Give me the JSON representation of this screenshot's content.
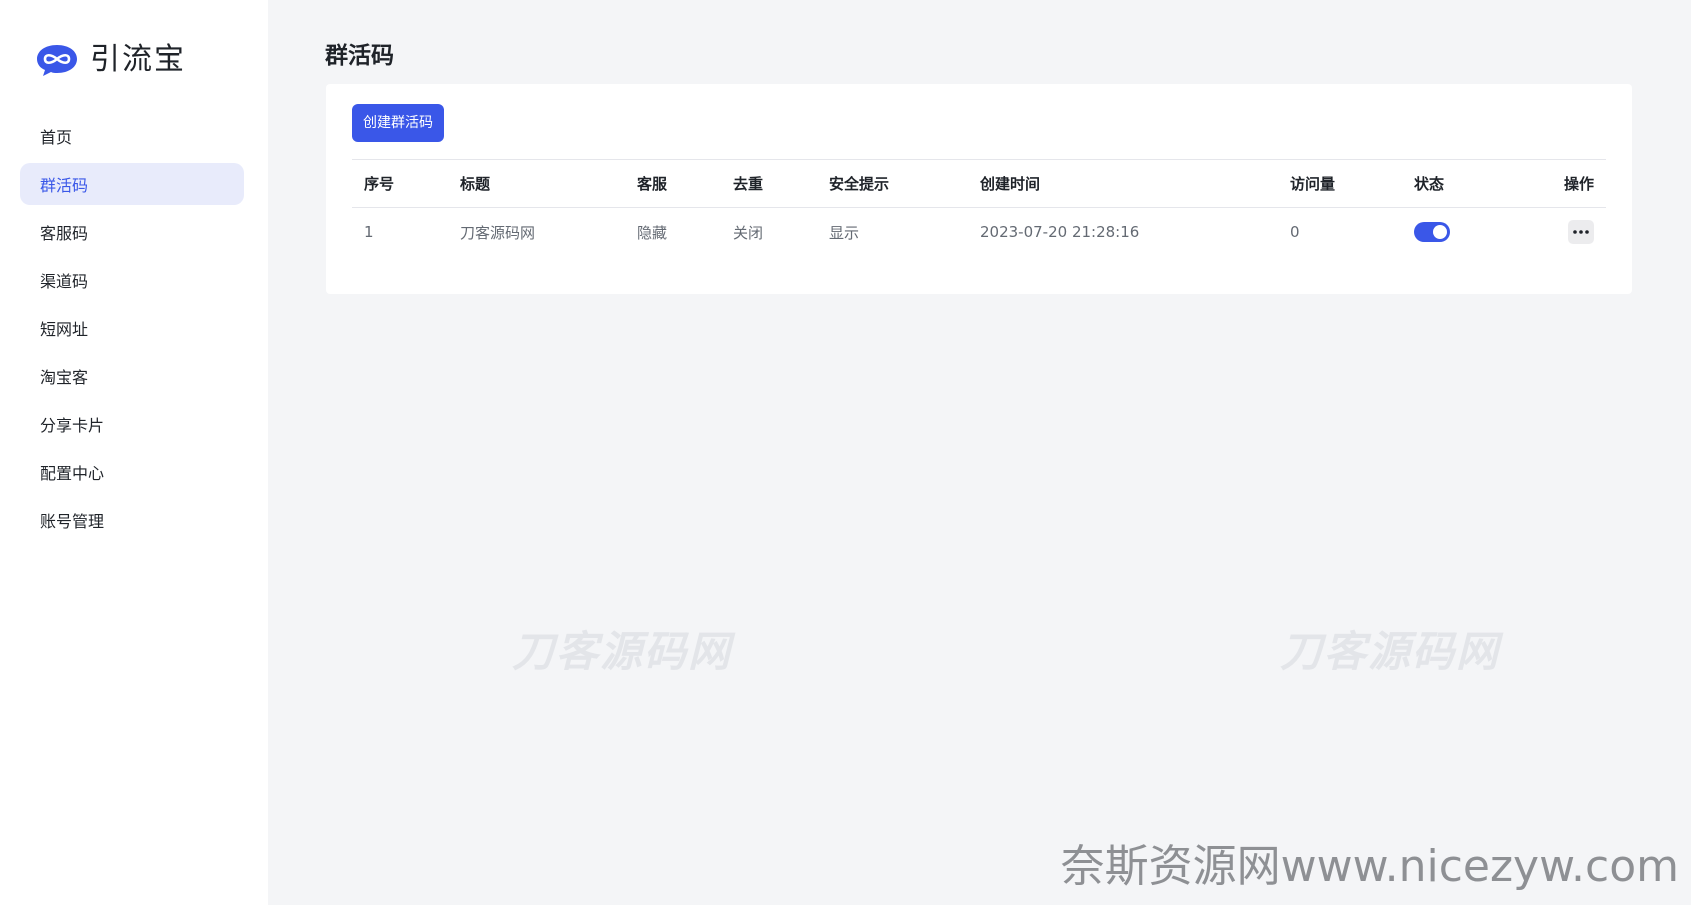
{
  "brand": {
    "name": "引流宝",
    "icon": "infinity-chat-logo-icon",
    "accent": "#3a57e8"
  },
  "sidebar": {
    "items": [
      {
        "label": "首页",
        "active": false
      },
      {
        "label": "群活码",
        "active": true
      },
      {
        "label": "客服码",
        "active": false
      },
      {
        "label": "渠道码",
        "active": false
      },
      {
        "label": "短网址",
        "active": false
      },
      {
        "label": "淘宝客",
        "active": false
      },
      {
        "label": "分享卡片",
        "active": false
      },
      {
        "label": "配置中心",
        "active": false
      },
      {
        "label": "账号管理",
        "active": false
      }
    ]
  },
  "page": {
    "title": "群活码",
    "create_button": "创建群活码"
  },
  "table": {
    "headers": {
      "idx": "序号",
      "title": "标题",
      "service": "客服",
      "dedupe": "去重",
      "safe": "安全提示",
      "created": "创建时间",
      "visits": "访问量",
      "status": "状态",
      "ops": "操作"
    },
    "rows": [
      {
        "idx": "1",
        "title": "刀客源码网",
        "service": "隐藏",
        "dedupe": "关闭",
        "safe": "显示",
        "created": "2023-07-20 21:28:16",
        "visits": "0",
        "status_on": true,
        "ops_icon": "more-dots-icon"
      }
    ]
  },
  "watermarks": {
    "center_left": "刀客源码网",
    "center_right": "刀客源码网",
    "bottom": "奈斯资源网www.nicezyw.com"
  },
  "colors": {
    "primary": "#3a57e8",
    "active_bg": "#e8ebfb",
    "page_bg": "#f4f5f7"
  }
}
